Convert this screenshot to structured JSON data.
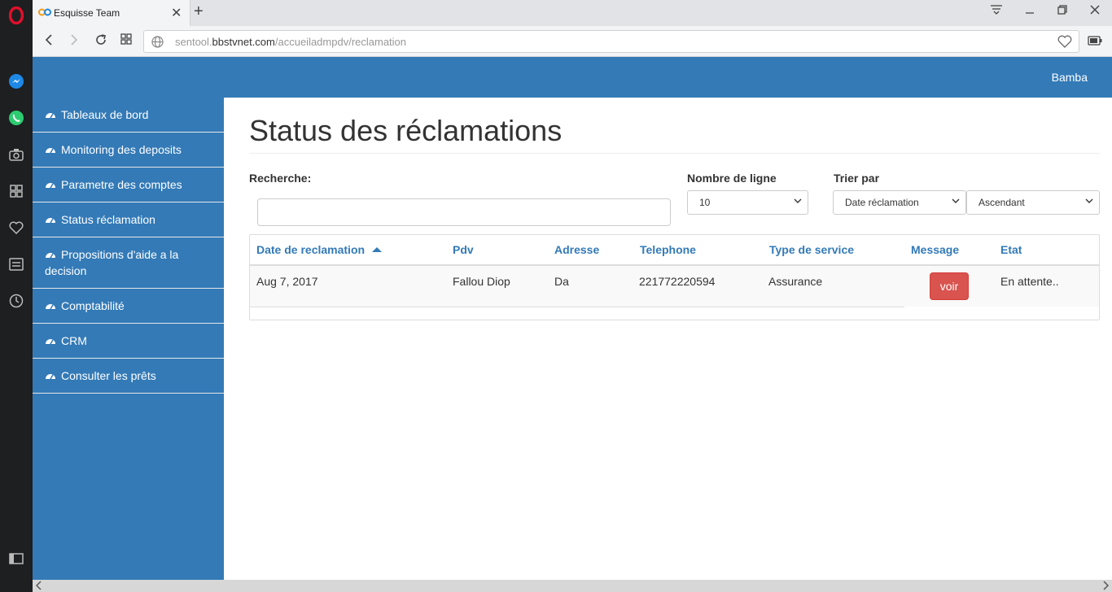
{
  "browser": {
    "tab_title": "Esquisse Team",
    "tab_close": "✕",
    "new_tab": "+",
    "url_prefix": "sentool.",
    "url_domain": "bbstvnet.com",
    "url_path": "/accueiladmpdv/reclamation"
  },
  "header": {
    "user": "Bamba"
  },
  "sidebar": {
    "items": [
      {
        "label": "Tableaux de bord"
      },
      {
        "label": "Monitoring des deposits"
      },
      {
        "label": "Parametre des comptes"
      },
      {
        "label": "Status réclamation"
      },
      {
        "label": "Propositions d'aide a la decision"
      },
      {
        "label": "Comptabilité"
      },
      {
        "label": "CRM"
      },
      {
        "label": "Consulter les prêts"
      }
    ]
  },
  "main": {
    "title": "Status des réclamations",
    "search_label": "Recherche:",
    "search_value": "",
    "rows_label": "Nombre de ligne",
    "rows_value": "10",
    "sort_label": "Trier par",
    "sort_field_value": "Date réclamation",
    "sort_order_value": "Ascendant"
  },
  "table": {
    "columns": [
      "Date de reclamation",
      "Pdv",
      "Adresse",
      "Telephone",
      "Type de service",
      "Message",
      "Etat"
    ],
    "sorted_column": "Date de reclamation",
    "sort_direction": "ascending",
    "rows": [
      {
        "date": "Aug 7, 2017",
        "pdv": "Fallou Diop",
        "adresse": "Da",
        "telephone": "221772220594",
        "type": "Assurance",
        "message_button": "voir",
        "etat": "En attente.."
      }
    ]
  },
  "colors": {
    "brand": "#337ab7",
    "danger": "#d9534f",
    "opera_red": "#e0102b"
  }
}
